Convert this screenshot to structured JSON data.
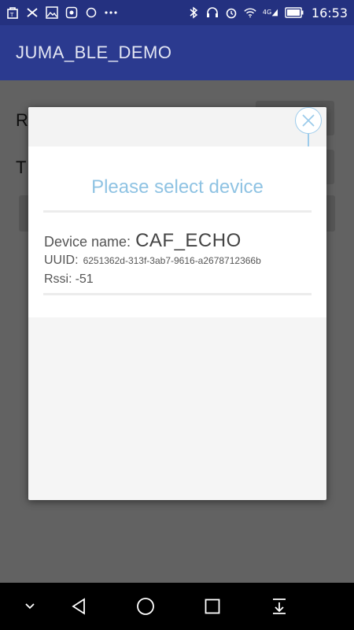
{
  "status_bar": {
    "time": "16:53",
    "network": "4G",
    "left_icons": [
      "shopping-bag-icon",
      "shuffle-icon",
      "image-icon",
      "grid-icon",
      "circle-icon",
      "more-icon"
    ],
    "right_icons": [
      "bluetooth-icon",
      "headset-icon",
      "alarm-icon",
      "wifi-icon",
      "signal-icon",
      "battery-icon"
    ]
  },
  "app_bar": {
    "title": "JUMA_BLE_DEMO"
  },
  "background": {
    "label_1": "R",
    "label_2": "T"
  },
  "dialog": {
    "title": "Please select device",
    "device": {
      "name_label": "Device name:",
      "name_value": "CAF_ECHO",
      "uuid_label": "UUID:",
      "uuid_value": "6251362d-313f-3ab7-9616-a2678712366b",
      "rssi_label": "Rssi:",
      "rssi_value": "-51"
    },
    "close_icon": "close-icon",
    "accent_color": "#8fc3e3"
  },
  "nav_bar": {
    "icons": [
      "chevron-down-icon",
      "back-icon",
      "home-icon",
      "recents-icon",
      "notification-pull-icon"
    ]
  }
}
